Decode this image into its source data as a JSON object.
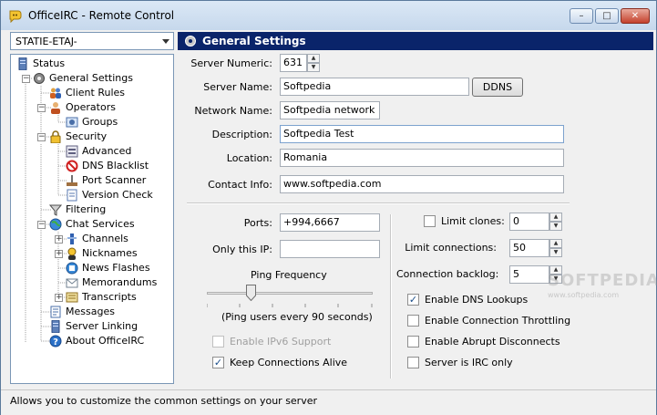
{
  "window": {
    "title": "OfficeIRC - Remote Control",
    "controls": {
      "minimize": "–",
      "maximize": "□",
      "close": "✕"
    }
  },
  "server_select": {
    "value": "STATIE-ETAJ-"
  },
  "tree": [
    {
      "label": "Status",
      "icon": "server-icon"
    },
    {
      "label": "General Settings",
      "icon": "gear-icon",
      "selected": true
    },
    {
      "label": "Client Rules",
      "icon": "users-icon"
    },
    {
      "label": "Operators",
      "icon": "operator-icon"
    },
    {
      "label": "Groups",
      "icon": "groups-icon"
    },
    {
      "label": "Security",
      "icon": "lock-icon"
    },
    {
      "label": "Advanced",
      "icon": "advanced-icon"
    },
    {
      "label": "DNS Blacklist",
      "icon": "blacklist-icon"
    },
    {
      "label": "Port Scanner",
      "icon": "scanner-icon"
    },
    {
      "label": "Version Check",
      "icon": "version-icon"
    },
    {
      "label": "Filtering",
      "icon": "filter-icon"
    },
    {
      "label": "Chat Services",
      "icon": "globe-icon"
    },
    {
      "label": "Channels",
      "icon": "channels-icon"
    },
    {
      "label": "Nicknames",
      "icon": "nicknames-icon"
    },
    {
      "label": "News Flashes",
      "icon": "news-icon"
    },
    {
      "label": "Memorandums",
      "icon": "memo-icon"
    },
    {
      "label": "Transcripts",
      "icon": "transcripts-icon"
    },
    {
      "label": "Messages",
      "icon": "messages-icon"
    },
    {
      "label": "Server Linking",
      "icon": "linking-icon"
    },
    {
      "label": "About OfficeIRC",
      "icon": "help-icon"
    }
  ],
  "panel": {
    "title": "General Settings",
    "server_numeric": {
      "label": "Server Numeric:",
      "value": "631"
    },
    "server_name": {
      "label": "Server Name:",
      "value": "Softpedia"
    },
    "ddns_button": "DDNS",
    "network_name": {
      "label": "Network Name:",
      "value": "Softpedia network"
    },
    "description": {
      "label": "Description:",
      "value": "Softpedia Test"
    },
    "location": {
      "label": "Location:",
      "value": "Romania"
    },
    "contact_info": {
      "label": "Contact Info:",
      "value": "www.softpedia.com"
    },
    "ports": {
      "label": "Ports:",
      "value": "+994,6667"
    },
    "only_this_ip": {
      "label": "Only this IP:",
      "value": ""
    },
    "ping": {
      "label": "Ping Frequency",
      "caption": "(Ping users every 90 seconds)",
      "level": 0.25
    },
    "enable_ipv6": {
      "label": "Enable IPv6 Support",
      "checked": false,
      "disabled": true
    },
    "keep_alive": {
      "label": "Keep Connections Alive",
      "checked": true
    },
    "limit_clones": {
      "label": "Limit clones:",
      "checked": false,
      "value": "0"
    },
    "limit_connections": {
      "label": "Limit connections:",
      "value": "50"
    },
    "connection_backlog": {
      "label": "Connection backlog:",
      "value": "5"
    },
    "enable_dns": {
      "label": "Enable DNS Lookups",
      "checked": true
    },
    "enable_throttling": {
      "label": "Enable Connection Throttling",
      "checked": false
    },
    "enable_abrupt": {
      "label": "Enable Abrupt Disconnects",
      "checked": false
    },
    "irc_only": {
      "label": "Server is IRC only",
      "checked": false
    }
  },
  "status_bar": "Allows you to customize the common settings on your server",
  "watermark": {
    "brand": "SOFTPEDIA",
    "site": "www.softpedia.com"
  },
  "colors": {
    "header_bg": "#0a246a",
    "accent": "#1a4d8a"
  }
}
